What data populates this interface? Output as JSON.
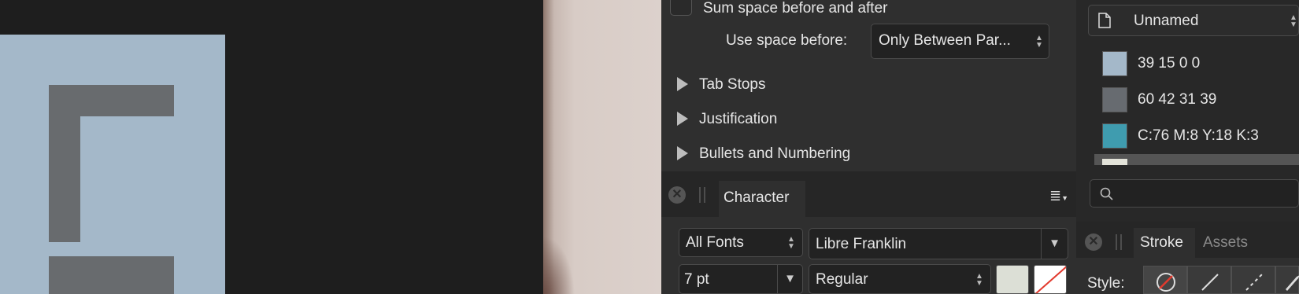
{
  "paragraph": {
    "sum_space_label": "Sum space before and after",
    "use_space_before_label": "Use space before:",
    "use_space_before_value": "Only Between Par...",
    "sections": [
      "Tab Stops",
      "Justification",
      "Bullets and Numbering"
    ]
  },
  "character": {
    "tab_label": "Character",
    "font_collection": "All Fonts",
    "font_family": "Libre Franklin",
    "font_size": "7 pt",
    "font_style": "Regular",
    "text_fill_color": "#dcdfd6"
  },
  "swatches": {
    "palette_name": "Unnamed",
    "items": [
      {
        "label": "39 15 0 0",
        "color": "#a4b8c9"
      },
      {
        "label": "60 42 31 39",
        "color": "#676b70"
      },
      {
        "label": "C:76 M:8 Y:18 K:3",
        "color": "#3f9caf"
      },
      {
        "label": "",
        "color": "#e3e3d9"
      }
    ]
  },
  "stroke": {
    "tabs": [
      "Stroke",
      "Assets"
    ],
    "style_label": "Style:"
  }
}
